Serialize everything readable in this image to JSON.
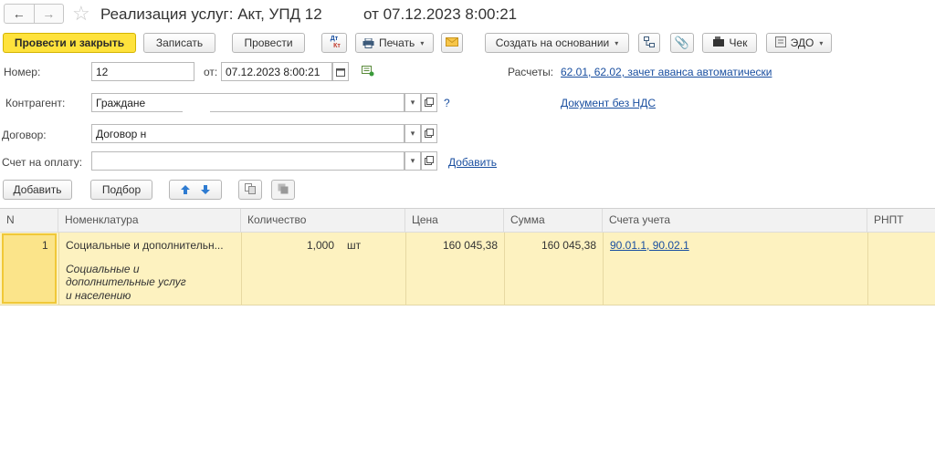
{
  "window": {
    "title": "Реализация услуг: Акт, УПД 12",
    "date_title": "от 07.12.2023 8:00:21"
  },
  "toolbar": {
    "post_close": "Провести и закрыть",
    "save": "Записать",
    "post": "Провести",
    "dt_kt_top": "Дт",
    "dt_kt_bottom": "Кт",
    "print": "Печать",
    "create_based": "Создать на основании",
    "receipt": "Чек",
    "edo": "ЭДО"
  },
  "form": {
    "number_label": "Номер:",
    "number_value": "12",
    "from_label": "от:",
    "date_value": "07.12.2023  8:00:21",
    "settlements_label": "Расчеты:",
    "settlements_link": "62.01, 62.02, зачет аванса автоматически",
    "counterparty_label": "Контрагент:",
    "counterparty_value": "Граждане",
    "help_mark": "?",
    "no_vat_link": "Документ без НДС",
    "contract_label": "Договор:",
    "contract_value": "Договор н",
    "invoice_label": "Счет на оплату:",
    "invoice_value": "",
    "add_link": "Добавить"
  },
  "table_toolbar": {
    "add": "Добавить",
    "pick": "Подбор"
  },
  "table": {
    "columns": [
      "N",
      "Номенклатура",
      "Количество",
      "Цена",
      "Сумма",
      "Счета учета",
      "РНПТ"
    ],
    "rows": [
      {
        "n": "1",
        "name": "Социальные и дополнительн...",
        "description_1": "Социальные и",
        "description_2": "дополнительные услуг",
        "description_3": "и населению",
        "qty": "1,000",
        "unit": "шт",
        "price": "160 045,38",
        "sum": "160 045,38",
        "accounts": "90.01.1, 90.02.1",
        "rnpt": ""
      }
    ]
  },
  "colors": {
    "primary_button": "#ffe23c",
    "row_selected": "#fdf2c0",
    "link": "#1a4fa0"
  }
}
